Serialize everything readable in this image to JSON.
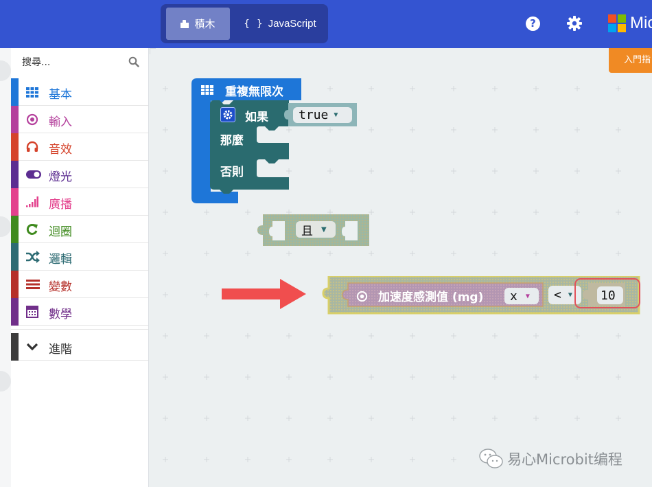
{
  "header": {
    "mode_tabs": [
      {
        "label": "積木",
        "icon": "puzzle-icon",
        "active": true
      },
      {
        "label": "JavaScript",
        "icon": "braces-icon",
        "icon_text": "{ }",
        "active": false
      }
    ],
    "help_icon": "?",
    "brand_text": "Mic",
    "colors": {
      "bar": "#3454d1",
      "switch_bg": "#2a3e9e",
      "active_tab": "#7281c6"
    }
  },
  "getting_started": {
    "label": "入門指"
  },
  "toolbox": {
    "search_placeholder": "搜尋...",
    "categories": [
      {
        "label": "基本",
        "icon": "grid-icon",
        "color": "#1e90ff"
      },
      {
        "label": "輸入",
        "icon": "target-icon",
        "color": "#b4409c"
      },
      {
        "label": "音效",
        "icon": "headphones-icon",
        "color": "#d5432b"
      },
      {
        "label": "燈光",
        "icon": "toggle-icon",
        "color": "#5c2d91"
      },
      {
        "label": "廣播",
        "icon": "signal-icon",
        "color": "#e3418d"
      },
      {
        "label": "迴圈",
        "icon": "refresh-icon",
        "color": "#3f8a1e"
      },
      {
        "label": "邏輯",
        "icon": "shuffle-icon",
        "color": "#2d6b73"
      },
      {
        "label": "變數",
        "icon": "list-icon",
        "color": "#b5302a"
      },
      {
        "label": "數學",
        "icon": "calculator-icon",
        "color": "#712f8a"
      }
    ],
    "advanced": {
      "label": "進階",
      "icon": "chevron-down-icon",
      "color": "#3c3c3c"
    }
  },
  "workspace": {
    "forever_block": {
      "label": "重複無限次",
      "color": "#1e76d8"
    },
    "if_block": {
      "if_label": "如果",
      "then_label": "那麼",
      "else_label": "否則",
      "color": "#2a6b6f"
    },
    "true_value": "true",
    "and_block": {
      "label": "且"
    },
    "accel_block": {
      "label": "加速度感測值 (mg)",
      "axis": "x"
    },
    "compare_op": "<",
    "number_value": "10"
  },
  "watermark": {
    "text": "易心Microbit编程"
  }
}
